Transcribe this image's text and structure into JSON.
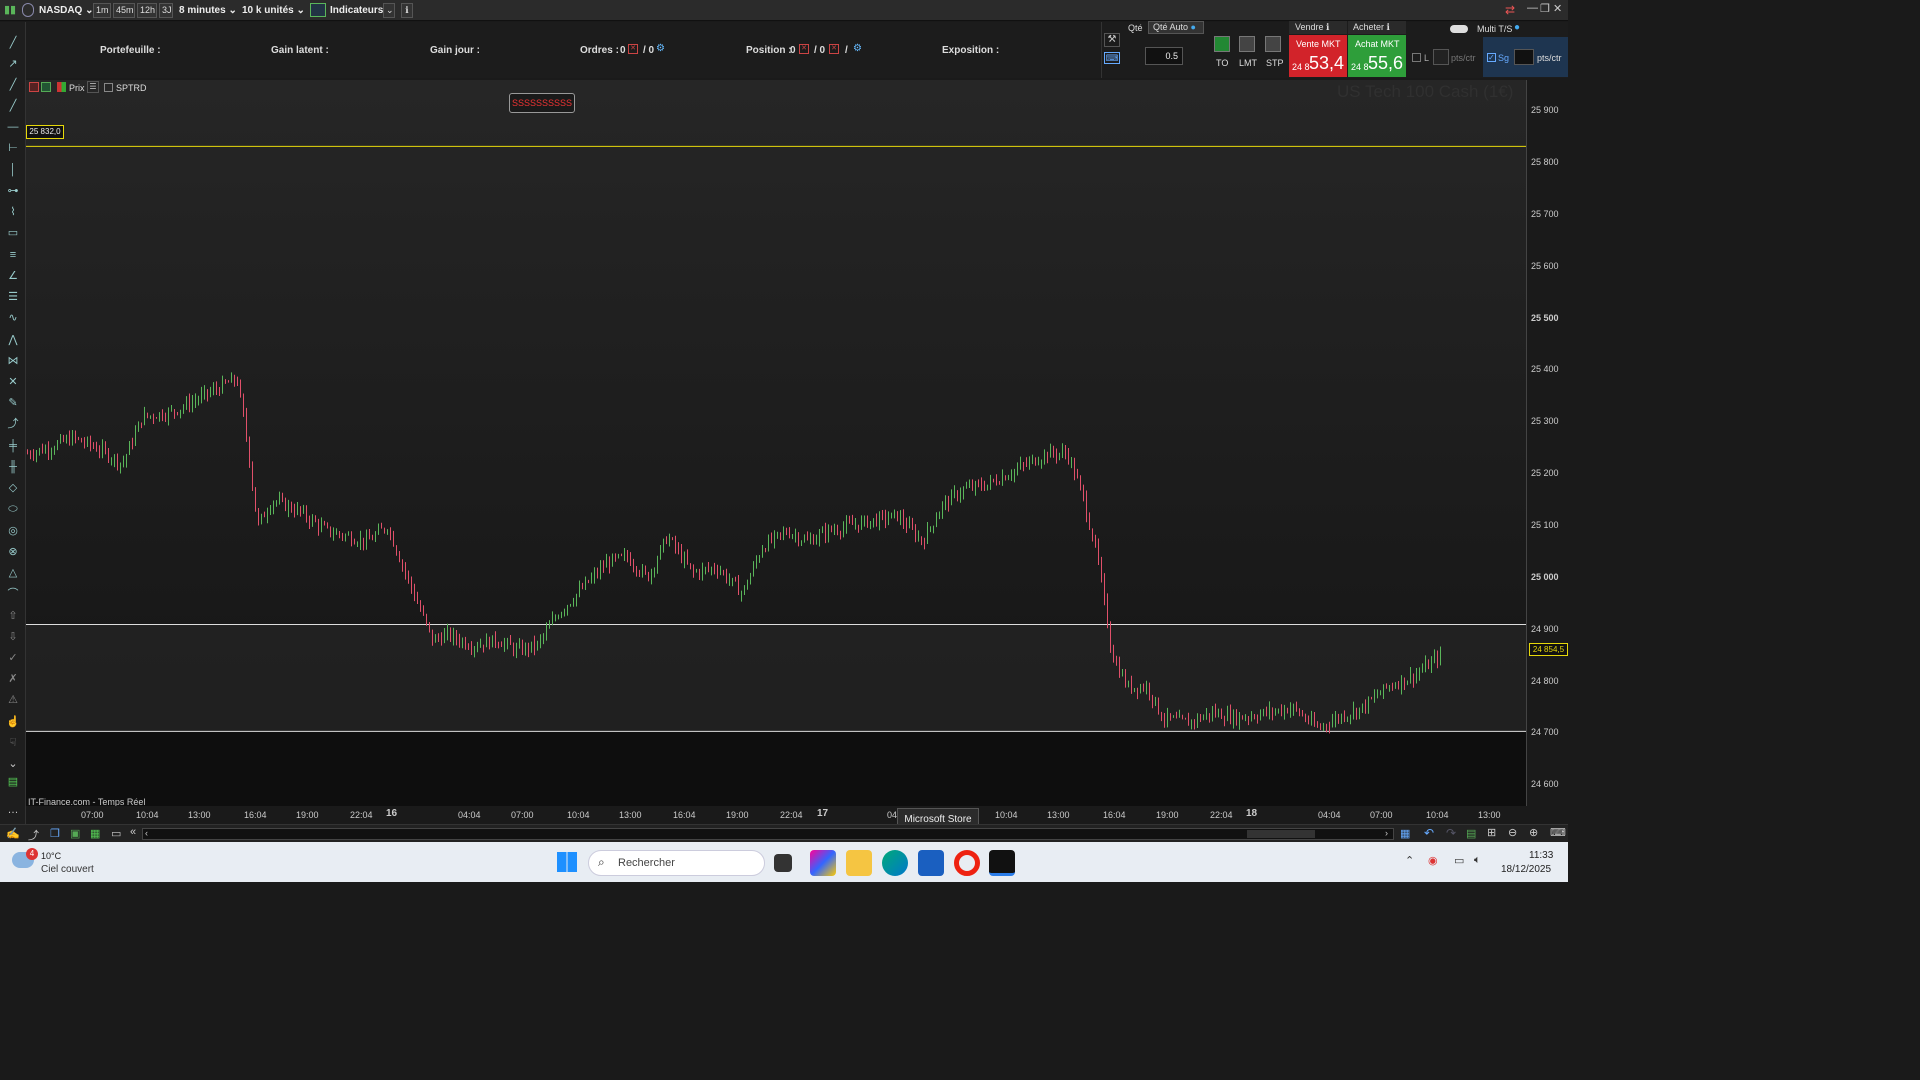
{
  "toolbar": {
    "market": "NASDAQ",
    "timeframes": [
      "1m",
      "45m",
      "12h",
      "3J"
    ],
    "interval": "8 minutes",
    "units": "10 k unités",
    "indicators_label": "Indicateurs"
  },
  "infobar": {
    "portefeuille": "Portefeuille :",
    "gain_latent": "Gain latent :",
    "gain_jour": "Gain jour :",
    "ordres_label": "Ordres :",
    "ordres_a": "0",
    "ordres_b": "/ 0",
    "position_label": "Position :",
    "position_a": "0",
    "position_b": "/ 0",
    "position_c": "/",
    "exposition": "Exposition :"
  },
  "order_panel": {
    "qty_label": "Qté",
    "qty_auto": "Qté Auto",
    "qty_value": "0.5",
    "to": "TO",
    "lmt": "LMT",
    "stp": "STP",
    "vendre": "Vendre",
    "acheter": "Acheter",
    "vente_mkt": "Vente MKT",
    "achat_mkt": "Achat MKT",
    "sell_prefix": "24 8",
    "sell_big": "53,4",
    "buy_prefix": "24 8",
    "buy_big": "55,6",
    "multi_ts": "Multi T/S",
    "l_label": "L",
    "pts_ctr_1": "pts/ctr",
    "sg_label": "Sg",
    "pts_ctr_2": "pts/ctr"
  },
  "chart_header": {
    "prix_label": "Prix",
    "sptrd_label": "SPTRD",
    "alert_text": "SSSSSSSSSS",
    "watermark": "US Tech 100 Cash (1€)",
    "line_label": "25 832,0",
    "current_price": "24 854,5",
    "source": "IT-Finance.com - Temps Réel"
  },
  "tooltip": "Microsoft Store",
  "taskbar": {
    "weather_temp": "10°C",
    "weather_desc": "Ciel couvert",
    "badge": "4",
    "search_placeholder": "Rechercher",
    "time": "11:33",
    "date": "18/12/2025"
  },
  "colors": {
    "up": "#5ab55a",
    "down": "#e0506a",
    "sell_bg": "#d2232a",
    "buy_bg": "#2e9e3a",
    "hline_yellow": "#e6d80a"
  },
  "chart_data": {
    "type": "candlestick",
    "y_ticks": [
      "25 900",
      "25 800",
      "25 700",
      "25 600",
      "25 500",
      "25 400",
      "25 300",
      "25 200",
      "25 100",
      "25 000",
      "24 900",
      "24 800",
      "24 700",
      "24 600"
    ],
    "y_range": [
      24560,
      25960
    ],
    "x_ticks": [
      "07:00",
      "10:04",
      "13:00",
      "16:04",
      "19:00",
      "22:04",
      "16",
      "04:04",
      "07:00",
      "10:04",
      "13:00",
      "16:04",
      "19:00",
      "22:04",
      "17",
      "04:04",
      "07:00",
      "10:04",
      "13:00",
      "16:04",
      "19:00",
      "22:04",
      "18",
      "04:04",
      "07:00",
      "10:04",
      "13:00"
    ],
    "horizontal_lines": [
      25832,
      24910,
      24704
    ],
    "last_price": 24854.5,
    "path_points": [
      [
        0,
        25240
      ],
      [
        20,
        25250
      ],
      [
        45,
        25270
      ],
      [
        70,
        25250
      ],
      [
        95,
        25220
      ],
      [
        115,
        25310
      ],
      [
        145,
        25320
      ],
      [
        175,
        25350
      ],
      [
        205,
        25380
      ],
      [
        210,
        25380
      ],
      [
        220,
        25260
      ],
      [
        230,
        25100
      ],
      [
        245,
        25150
      ],
      [
        270,
        25130
      ],
      [
        300,
        25090
      ],
      [
        340,
        25070
      ],
      [
        360,
        25100
      ],
      [
        380,
        25000
      ],
      [
        405,
        24880
      ],
      [
        420,
        24890
      ],
      [
        445,
        24870
      ],
      [
        470,
        24880
      ],
      [
        490,
        24860
      ],
      [
        510,
        24870
      ],
      [
        530,
        24930
      ],
      [
        555,
        24980
      ],
      [
        580,
        25030
      ],
      [
        600,
        25040
      ],
      [
        620,
        25000
      ],
      [
        640,
        25080
      ],
      [
        665,
        25010
      ],
      [
        690,
        25020
      ],
      [
        715,
        24970
      ],
      [
        735,
        25060
      ],
      [
        760,
        25090
      ],
      [
        780,
        25070
      ],
      [
        800,
        25090
      ],
      [
        820,
        25100
      ],
      [
        845,
        25110
      ],
      [
        870,
        25120
      ],
      [
        895,
        25070
      ],
      [
        915,
        25140
      ],
      [
        935,
        25170
      ],
      [
        960,
        25180
      ],
      [
        990,
        25210
      ],
      [
        1020,
        25240
      ],
      [
        1040,
        25240
      ],
      [
        1055,
        25160
      ],
      [
        1070,
        25040
      ],
      [
        1085,
        24850
      ],
      [
        1100,
        24790
      ],
      [
        1120,
        24790
      ],
      [
        1135,
        24730
      ],
      [
        1160,
        24720
      ],
      [
        1185,
        24740
      ],
      [
        1210,
        24730
      ],
      [
        1240,
        24740
      ],
      [
        1265,
        24750
      ],
      [
        1290,
        24710
      ],
      [
        1310,
        24730
      ],
      [
        1335,
        24750
      ],
      [
        1360,
        24790
      ],
      [
        1385,
        24810
      ],
      [
        1400,
        24830
      ],
      [
        1415,
        24855
      ]
    ]
  }
}
